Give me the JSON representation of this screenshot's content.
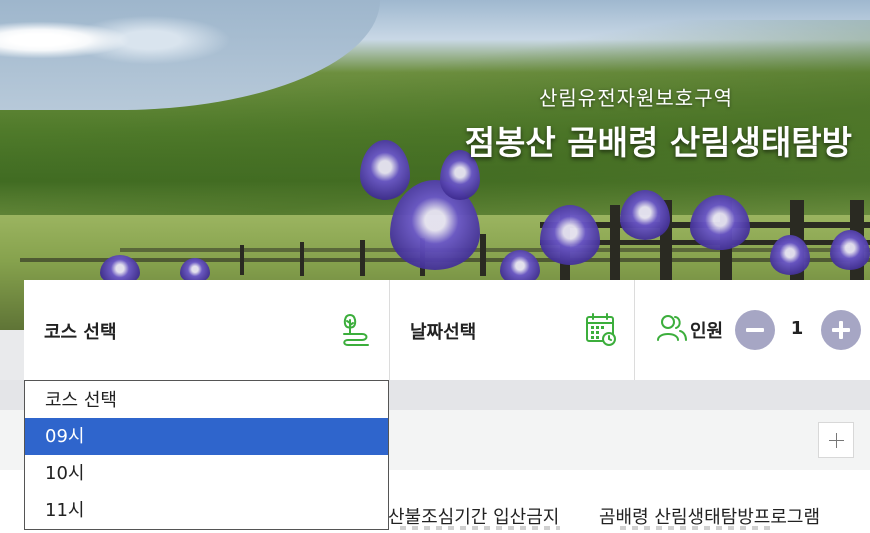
{
  "hero": {
    "subtitle": "산림유전자원보호구역",
    "title": "점봉산 곰배령 산림생태탐방"
  },
  "filter": {
    "course_label": "코스 선택",
    "course_icon": "tree-trail-icon",
    "date_label": "날짜선택",
    "date_icon": "calendar-icon",
    "people_icon": "people-icon",
    "people_label": "인원",
    "count": "1",
    "accent_color": "#3cae3c",
    "stepper_color": "#a6a6c4"
  },
  "dropdown": {
    "options": [
      {
        "label": "코스 선택",
        "selected": false
      },
      {
        "label": "09시",
        "selected": true
      },
      {
        "label": "10시",
        "selected": false
      },
      {
        "label": "11시",
        "selected": false
      }
    ],
    "selected_color": "#2f65cc"
  },
  "notices": [
    "산불조심기간 입산금지",
    "곰배령 산림생태탐방프로그램"
  ]
}
